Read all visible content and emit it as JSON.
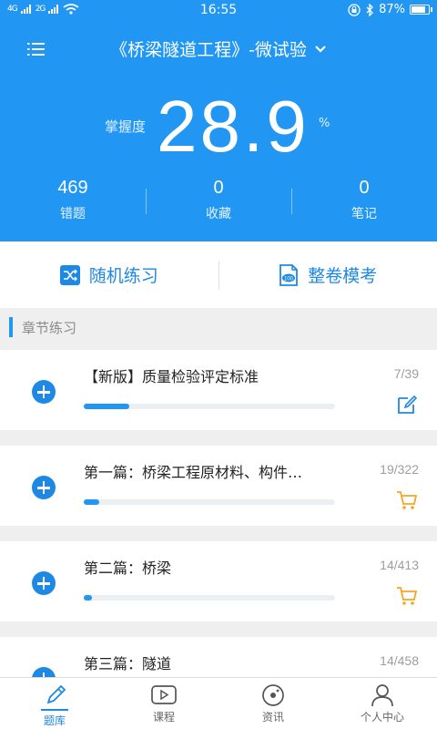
{
  "status_bar": {
    "signal_left": "4G",
    "signal_right": "2G",
    "time": "16:55",
    "battery": "87%",
    "battery_level": 0.87
  },
  "header": {
    "title": "《桥梁隧道工程》-微试验",
    "mastery_label": "掌握度",
    "mastery_value": "28.9",
    "mastery_unit": "%",
    "accent_color": "#2196f3"
  },
  "stats": [
    {
      "value": "469",
      "label": "错题"
    },
    {
      "value": "0",
      "label": "收藏"
    },
    {
      "value": "0",
      "label": "笔记"
    }
  ],
  "actions": {
    "random": "随机练习",
    "full_exam": "整卷模考"
  },
  "section": {
    "title": "章节练习"
  },
  "chapters": [
    {
      "name": "【新版】质量检验评定标准",
      "count": "7/39",
      "progress": 0.18,
      "icon": "edit-icon"
    },
    {
      "name": "第一篇：桥梁工程原材料、构件…",
      "count": "19/322",
      "progress": 0.06,
      "icon": "cart-icon"
    },
    {
      "name": "第二篇：桥梁",
      "count": "14/413",
      "progress": 0.034,
      "icon": "cart-icon"
    },
    {
      "name": "第三篇：隧道",
      "count": "14/458",
      "progress": 0.03,
      "icon": "cart-icon"
    }
  ],
  "nav": [
    {
      "label": "题库",
      "icon": "pencil-icon",
      "active": true
    },
    {
      "label": "课程",
      "icon": "play-icon",
      "active": false
    },
    {
      "label": "资讯",
      "icon": "news-icon",
      "active": false
    },
    {
      "label": "个人中心",
      "icon": "person-icon",
      "active": false
    }
  ],
  "colors": {
    "primary": "#2196f3",
    "cart": "#f5a623",
    "background": "#efefef"
  }
}
